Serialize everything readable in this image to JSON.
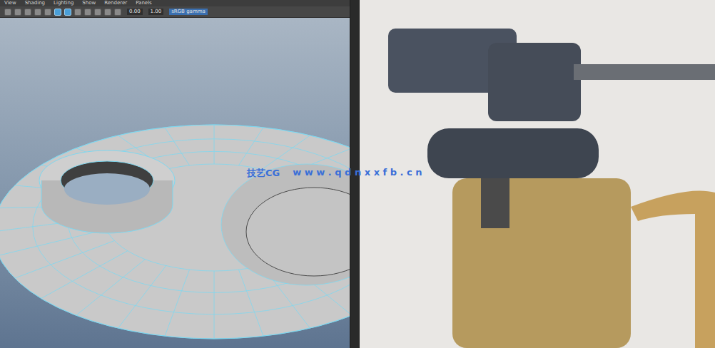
{
  "viewport": {
    "menu": [
      {
        "label": "View"
      },
      {
        "label": "Shading"
      },
      {
        "label": "Lighting"
      },
      {
        "label": "Show"
      },
      {
        "label": "Renderer"
      },
      {
        "label": "Panels"
      }
    ],
    "toolbar": {
      "icons": [
        {
          "selected": false
        },
        {
          "selected": false
        },
        {
          "selected": false
        },
        {
          "selected": false
        },
        {
          "selected": false
        },
        {
          "selected": true
        },
        {
          "selected": true
        },
        {
          "selected": false
        },
        {
          "selected": false
        },
        {
          "selected": false
        },
        {
          "selected": false
        },
        {
          "selected": false
        }
      ],
      "exposure": "0.00",
      "gamma": "1.00",
      "colorspace": "sRGB gamma"
    }
  },
  "watermark": {
    "brand": "技艺CG",
    "url": "w w w . q d n x x f b . c n"
  }
}
